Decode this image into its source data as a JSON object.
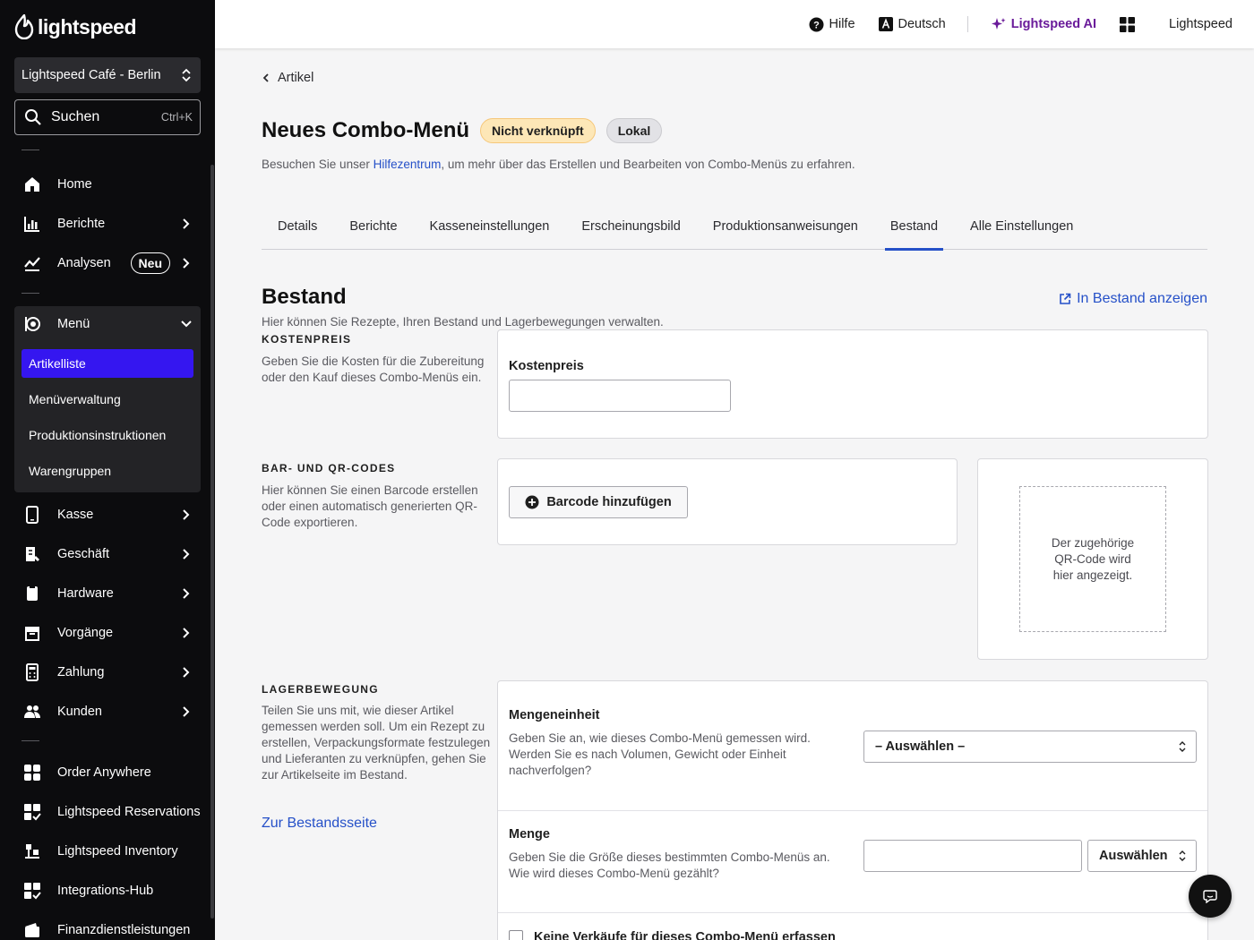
{
  "brand": {
    "name": "lightspeed"
  },
  "store": {
    "name": "Lightspeed Café - Berlin"
  },
  "search": {
    "label": "Suchen",
    "shortcut": "Ctrl+K"
  },
  "nav": {
    "home": "Home",
    "reports": "Berichte",
    "analytics": "Analysen",
    "analytics_badge": "Neu",
    "menu": "Menü",
    "menu_sub": [
      "Artikelliste",
      "Menüverwaltung",
      "Produktionsinstruktionen",
      "Warengruppen"
    ],
    "pos": "Kasse",
    "business": "Geschäft",
    "hardware": "Hardware",
    "transactions": "Vorgänge",
    "payment": "Zahlung",
    "customers": "Kunden",
    "order_anywhere": "Order Anywhere",
    "reservations": "Lightspeed Reservations",
    "inventory": "Lightspeed Inventory",
    "integrations": "Integrations-Hub",
    "financial": "Finanzdienstleistungen"
  },
  "topbar": {
    "help": "Hilfe",
    "language": "Deutsch",
    "ai": "Lightspeed AI",
    "account": "Lightspeed"
  },
  "page": {
    "back": "Artikel",
    "title": "Neues Combo-Menü",
    "badge_status": "Nicht verknüpft",
    "badge_scope": "Lokal",
    "subtitle_pre": "Besuchen Sie unser ",
    "subtitle_link": "Hilfezentrum",
    "subtitle_post": ", um mehr über das Erstellen und Bearbeiten von Combo-Menüs zu erfahren."
  },
  "tabs": [
    "Details",
    "Berichte",
    "Kasseneinstellungen",
    "Erscheinungsbild",
    "Produktionsanweisungen",
    "Bestand",
    "Alle Einstellungen"
  ],
  "inventory": {
    "heading": "Bestand",
    "view_link": "In Bestand anzeigen",
    "description": "Hier können Sie Rezepte, Ihren Bestand und Lagerbewegungen verwalten.",
    "cost": {
      "section": "KOSTENPREIS",
      "section_desc": "Geben Sie die Kosten für die Zubereitung oder den Kauf dieses Combo-Menüs ein.",
      "label": "Kostenpreis",
      "value": ""
    },
    "codes": {
      "section": "BAR- UND QR-CODES",
      "section_desc": "Hier können Sie einen Barcode erstellen oder einen automatisch generierten QR-Code exportieren.",
      "add_barcode": "Barcode hinzufügen",
      "qr_placeholder": "Der zugehörige QR-Code wird hier angezeigt."
    },
    "movement": {
      "section": "LAGERBEWEGUNG",
      "section_desc": "Teilen Sie uns mit, wie dieser Artikel gemessen werden soll. Um ein Rezept zu erstellen, Verpackungsformate festzulegen und Lieferanten zu verknüpfen, gehen Sie zur Artikelseite im Bestand.",
      "link": "Zur Bestandsseite",
      "unit_label": "Mengeneinheit",
      "unit_help": "Geben Sie an, wie dieses Combo-Menü gemessen wird. Werden Sie es nach Volumen, Gewicht oder Einheit nachverfolgen?",
      "unit_select": "– Auswählen –",
      "qty_label": "Menge",
      "qty_help": "Geben Sie die Größe dieses bestimmten Combo-Menüs an. Wie wird dieses Combo-Menü gezählt?",
      "qty_value": "",
      "qty_select": "Auswählen",
      "no_sales_checkbox": "Keine Verkäufe für dieses Combo-Menü erfassen"
    }
  }
}
